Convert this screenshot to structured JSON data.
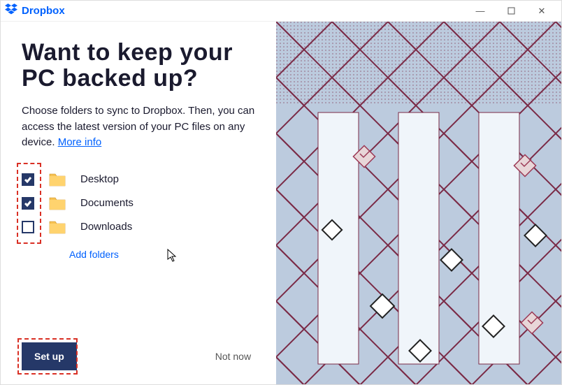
{
  "titlebar": {
    "app_name": "Dropbox"
  },
  "main": {
    "heading": "Want to keep your PC backed up?",
    "desc_text": "Choose folders to sync to Dropbox. Then, you can access the latest version of your PC files on any device. ",
    "more_info_label": "More info"
  },
  "folders": {
    "items": [
      {
        "label": "Desktop",
        "checked": true
      },
      {
        "label": "Documents",
        "checked": true
      },
      {
        "label": "Downloads",
        "checked": false
      }
    ],
    "add_label": "Add folders"
  },
  "buttons": {
    "setup_label": "Set up",
    "not_now_label": "Not now"
  },
  "colors": {
    "brand_blue": "#0061fe",
    "primary_dark": "#253868",
    "highlight_red": "#d93025"
  }
}
